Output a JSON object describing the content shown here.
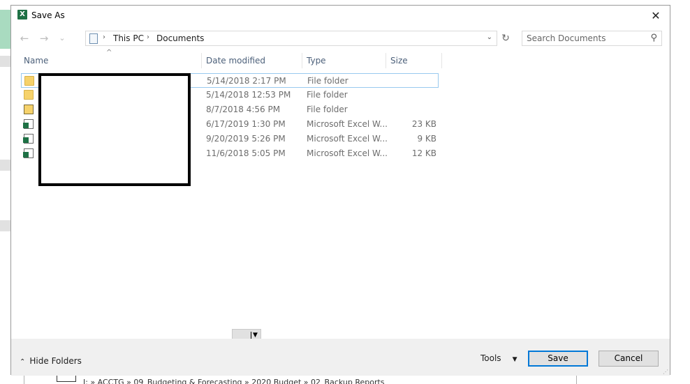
{
  "background": {
    "bottom_path": "J: » ACCTG » 09_Budgeting & Forecasting » 2020 Budget » 02_Backup Reports"
  },
  "dialog": {
    "app_icon_letter": "X",
    "title": "Save As",
    "close_glyph": "✕"
  },
  "nav": {
    "back_glyph": "←",
    "forward_glyph": "→",
    "recent_glyph": "⌄",
    "breadcrumb": [
      "This PC",
      "Documents"
    ],
    "breadcrumb_separator": "›",
    "address_dropdown_glyph": "⌄",
    "refresh_glyph": "↻"
  },
  "search": {
    "placeholder": "Search Documents",
    "icon": "search-icon",
    "icon_glyph": "⚲"
  },
  "columns": {
    "sort_caret": "^",
    "name": "Name",
    "date": "Date modified",
    "type": "Type",
    "size": "Size"
  },
  "files": [
    {
      "icon": "folder-icon",
      "date": "5/14/2018 2:17 PM",
      "type": "File folder",
      "size": "",
      "selected": true
    },
    {
      "icon": "folder-icon",
      "date": "5/14/2018 12:53 PM",
      "type": "File folder",
      "size": "",
      "selected": false
    },
    {
      "icon": "special-folder-icon",
      "date": "8/7/2018 4:56 PM",
      "type": "File folder",
      "size": "",
      "selected": false
    },
    {
      "icon": "excel-file-icon",
      "date": "6/17/2019 1:30 PM",
      "type": "Microsoft Excel W...",
      "size": "23 KB",
      "selected": false
    },
    {
      "icon": "excel-file-icon",
      "date": "9/20/2019 5:26 PM",
      "type": "Microsoft Excel W...",
      "size": "9 KB",
      "selected": false
    },
    {
      "icon": "excel-file-icon",
      "date": "11/6/2018 5:05 PM",
      "type": "Microsoft Excel W...",
      "size": "12 KB",
      "selected": false
    }
  ],
  "mini_combo": {
    "arrow_glyph": "▼"
  },
  "footer": {
    "hide_folders_glyph": "⌃",
    "hide_folders_label": "Hide Folders",
    "tools_label": "Tools",
    "tools_arrow": "▼",
    "save_label": "Save",
    "cancel_label": "Cancel",
    "grip_glyph": "⋰"
  }
}
